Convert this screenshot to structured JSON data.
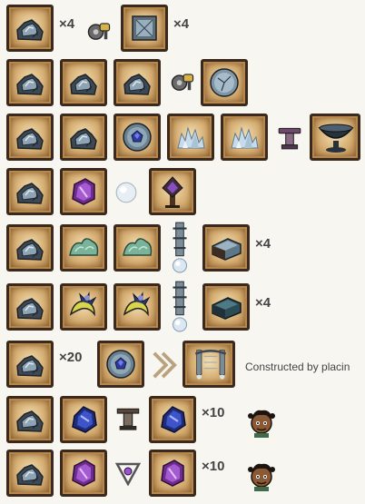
{
  "recipes": [
    {
      "count_a": "×4",
      "count_b": "×4"
    },
    {},
    {},
    {},
    {
      "count": "×4"
    },
    {
      "count": "×4"
    },
    {
      "count_in": "×20",
      "description": "Constructed by placin"
    },
    {
      "count": "×10"
    },
    {
      "count": "×10"
    }
  ],
  "colors": {
    "page_bg": "#f7f6f1",
    "slot_border": "#3b2a1c",
    "slot_fill": "#d4ab6f",
    "text": "#444444"
  }
}
